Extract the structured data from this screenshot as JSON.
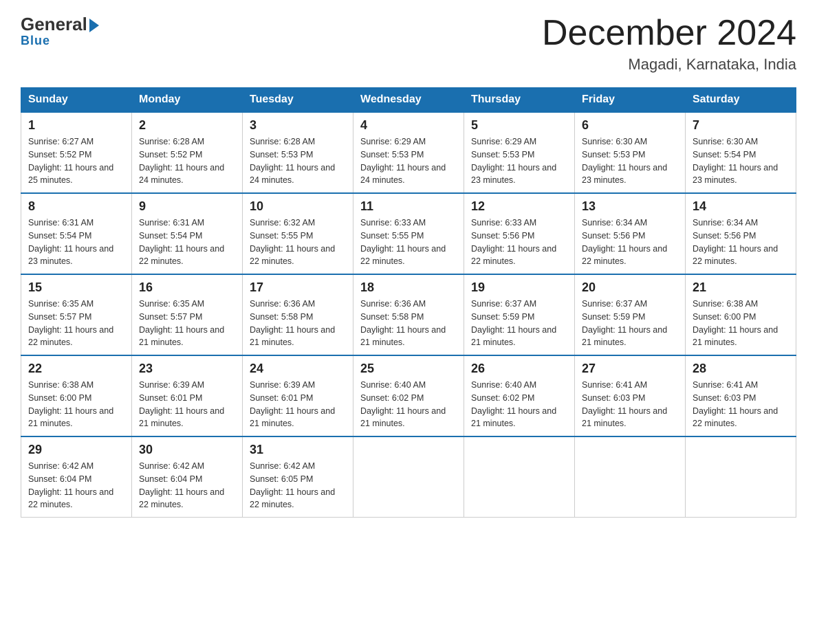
{
  "logo": {
    "general": "General",
    "blue": "Blue"
  },
  "header": {
    "month": "December 2024",
    "location": "Magadi, Karnataka, India"
  },
  "days_of_week": [
    "Sunday",
    "Monday",
    "Tuesday",
    "Wednesday",
    "Thursday",
    "Friday",
    "Saturday"
  ],
  "weeks": [
    [
      {
        "day": "1",
        "sunrise": "6:27 AM",
        "sunset": "5:52 PM",
        "daylight": "11 hours and 25 minutes."
      },
      {
        "day": "2",
        "sunrise": "6:28 AM",
        "sunset": "5:52 PM",
        "daylight": "11 hours and 24 minutes."
      },
      {
        "day": "3",
        "sunrise": "6:28 AM",
        "sunset": "5:53 PM",
        "daylight": "11 hours and 24 minutes."
      },
      {
        "day": "4",
        "sunrise": "6:29 AM",
        "sunset": "5:53 PM",
        "daylight": "11 hours and 24 minutes."
      },
      {
        "day": "5",
        "sunrise": "6:29 AM",
        "sunset": "5:53 PM",
        "daylight": "11 hours and 23 minutes."
      },
      {
        "day": "6",
        "sunrise": "6:30 AM",
        "sunset": "5:53 PM",
        "daylight": "11 hours and 23 minutes."
      },
      {
        "day": "7",
        "sunrise": "6:30 AM",
        "sunset": "5:54 PM",
        "daylight": "11 hours and 23 minutes."
      }
    ],
    [
      {
        "day": "8",
        "sunrise": "6:31 AM",
        "sunset": "5:54 PM",
        "daylight": "11 hours and 23 minutes."
      },
      {
        "day": "9",
        "sunrise": "6:31 AM",
        "sunset": "5:54 PM",
        "daylight": "11 hours and 22 minutes."
      },
      {
        "day": "10",
        "sunrise": "6:32 AM",
        "sunset": "5:55 PM",
        "daylight": "11 hours and 22 minutes."
      },
      {
        "day": "11",
        "sunrise": "6:33 AM",
        "sunset": "5:55 PM",
        "daylight": "11 hours and 22 minutes."
      },
      {
        "day": "12",
        "sunrise": "6:33 AM",
        "sunset": "5:56 PM",
        "daylight": "11 hours and 22 minutes."
      },
      {
        "day": "13",
        "sunrise": "6:34 AM",
        "sunset": "5:56 PM",
        "daylight": "11 hours and 22 minutes."
      },
      {
        "day": "14",
        "sunrise": "6:34 AM",
        "sunset": "5:56 PM",
        "daylight": "11 hours and 22 minutes."
      }
    ],
    [
      {
        "day": "15",
        "sunrise": "6:35 AM",
        "sunset": "5:57 PM",
        "daylight": "11 hours and 22 minutes."
      },
      {
        "day": "16",
        "sunrise": "6:35 AM",
        "sunset": "5:57 PM",
        "daylight": "11 hours and 21 minutes."
      },
      {
        "day": "17",
        "sunrise": "6:36 AM",
        "sunset": "5:58 PM",
        "daylight": "11 hours and 21 minutes."
      },
      {
        "day": "18",
        "sunrise": "6:36 AM",
        "sunset": "5:58 PM",
        "daylight": "11 hours and 21 minutes."
      },
      {
        "day": "19",
        "sunrise": "6:37 AM",
        "sunset": "5:59 PM",
        "daylight": "11 hours and 21 minutes."
      },
      {
        "day": "20",
        "sunrise": "6:37 AM",
        "sunset": "5:59 PM",
        "daylight": "11 hours and 21 minutes."
      },
      {
        "day": "21",
        "sunrise": "6:38 AM",
        "sunset": "6:00 PM",
        "daylight": "11 hours and 21 minutes."
      }
    ],
    [
      {
        "day": "22",
        "sunrise": "6:38 AM",
        "sunset": "6:00 PM",
        "daylight": "11 hours and 21 minutes."
      },
      {
        "day": "23",
        "sunrise": "6:39 AM",
        "sunset": "6:01 PM",
        "daylight": "11 hours and 21 minutes."
      },
      {
        "day": "24",
        "sunrise": "6:39 AM",
        "sunset": "6:01 PM",
        "daylight": "11 hours and 21 minutes."
      },
      {
        "day": "25",
        "sunrise": "6:40 AM",
        "sunset": "6:02 PM",
        "daylight": "11 hours and 21 minutes."
      },
      {
        "day": "26",
        "sunrise": "6:40 AM",
        "sunset": "6:02 PM",
        "daylight": "11 hours and 21 minutes."
      },
      {
        "day": "27",
        "sunrise": "6:41 AM",
        "sunset": "6:03 PM",
        "daylight": "11 hours and 21 minutes."
      },
      {
        "day": "28",
        "sunrise": "6:41 AM",
        "sunset": "6:03 PM",
        "daylight": "11 hours and 22 minutes."
      }
    ],
    [
      {
        "day": "29",
        "sunrise": "6:42 AM",
        "sunset": "6:04 PM",
        "daylight": "11 hours and 22 minutes."
      },
      {
        "day": "30",
        "sunrise": "6:42 AM",
        "sunset": "6:04 PM",
        "daylight": "11 hours and 22 minutes."
      },
      {
        "day": "31",
        "sunrise": "6:42 AM",
        "sunset": "6:05 PM",
        "daylight": "11 hours and 22 minutes."
      },
      null,
      null,
      null,
      null
    ]
  ]
}
